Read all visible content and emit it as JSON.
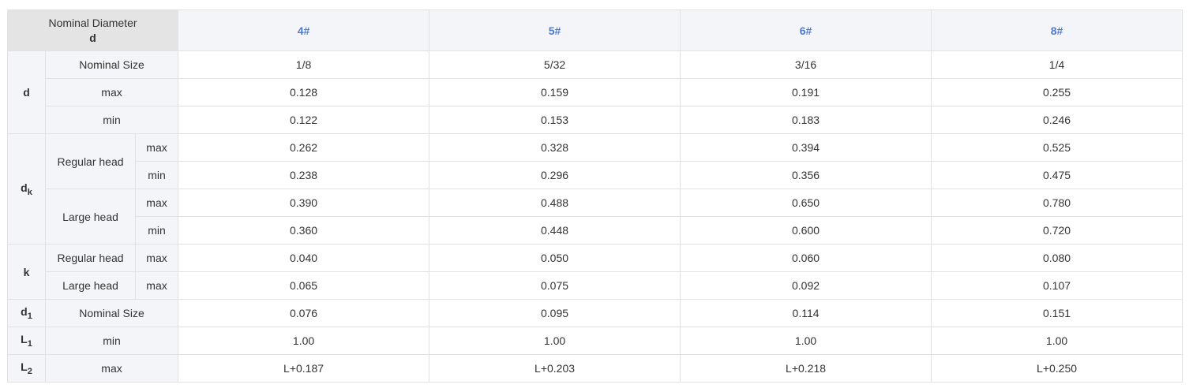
{
  "header": {
    "corner_line1": "Nominal Diameter",
    "corner_line2": "d",
    "columns": [
      "4#",
      "5#",
      "6#",
      "8#"
    ]
  },
  "groups": {
    "d": "d",
    "dk_base": "d",
    "dk_sub": "k",
    "k": "k",
    "d1_base": "d",
    "d1_sub": "1",
    "L1_base": "L",
    "L1_sub": "1",
    "L2_base": "L",
    "L2_sub": "2"
  },
  "labels": {
    "nominal_size": "Nominal Size",
    "max": "max",
    "min": "min",
    "regular_head": "Regular head",
    "large_head": "Large head"
  },
  "rows": {
    "d_nominal": [
      "1/8",
      "5/32",
      "3/16",
      "1/4"
    ],
    "d_max": [
      "0.128",
      "0.159",
      "0.191",
      "0.255"
    ],
    "d_min": [
      "0.122",
      "0.153",
      "0.183",
      "0.246"
    ],
    "dk_regular_max": [
      "0.262",
      "0.328",
      "0.394",
      "0.525"
    ],
    "dk_regular_min": [
      "0.238",
      "0.296",
      "0.356",
      "0.475"
    ],
    "dk_large_max": [
      "0.390",
      "0.488",
      "0.650",
      "0.780"
    ],
    "dk_large_min": [
      "0.360",
      "0.448",
      "0.600",
      "0.720"
    ],
    "k_regular_max": [
      "0.040",
      "0.050",
      "0.060",
      "0.080"
    ],
    "k_large_max": [
      "0.065",
      "0.075",
      "0.092",
      "0.107"
    ],
    "d1_nominal": [
      "0.076",
      "0.095",
      "0.114",
      "0.151"
    ],
    "L1_min": [
      "1.00",
      "1.00",
      "1.00",
      "1.00"
    ],
    "L2_max": [
      "L+0.187",
      "L+0.203",
      "L+0.218",
      "L+0.250"
    ]
  },
  "colors": {
    "header_text": "#4a7bd6",
    "corner_bg": "#e4e4e4",
    "label_bg": "#f4f5f8",
    "border": "#e2e2e2"
  }
}
